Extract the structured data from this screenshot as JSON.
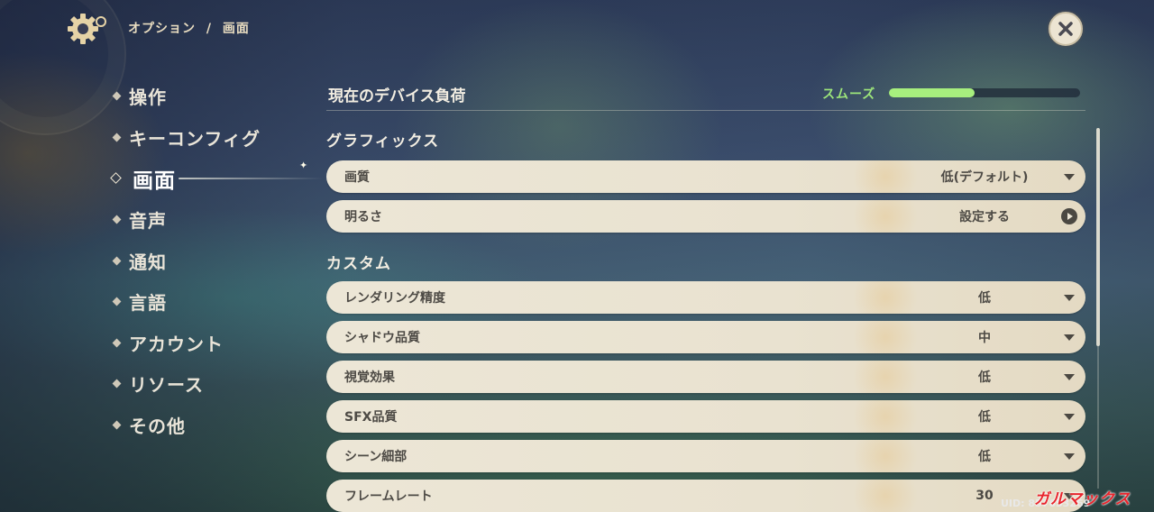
{
  "header": {
    "breadcrumb_root": "オプション",
    "breadcrumb_sep": "/",
    "breadcrumb_current": "画面"
  },
  "sidebar": {
    "items": [
      {
        "label": "操作"
      },
      {
        "label": "キーコンフィグ"
      },
      {
        "label": "画面",
        "active": true
      },
      {
        "label": "音声"
      },
      {
        "label": "通知"
      },
      {
        "label": "言語"
      },
      {
        "label": "アカウント"
      },
      {
        "label": "リソース"
      },
      {
        "label": "その他"
      }
    ]
  },
  "device_load": {
    "label": "現在のデバイス負荷",
    "status": "スムーズ",
    "level": 0.45,
    "color": "#a7ef7e"
  },
  "graphics": {
    "title": "グラフィックス",
    "rows": [
      {
        "label": "画質",
        "value": "低(デフォルト)",
        "control": "dropdown"
      },
      {
        "label": "明るさ",
        "value": "設定する",
        "control": "action"
      }
    ]
  },
  "custom": {
    "title": "カスタム",
    "rows": [
      {
        "label": "レンダリング精度",
        "value": "低",
        "control": "dropdown"
      },
      {
        "label": "シャドウ品質",
        "value": "中",
        "control": "dropdown"
      },
      {
        "label": "視覚効果",
        "value": "低",
        "control": "dropdown"
      },
      {
        "label": "SFX品質",
        "value": "低",
        "control": "dropdown"
      },
      {
        "label": "シーン細部",
        "value": "低",
        "control": "dropdown"
      },
      {
        "label": "フレームレート",
        "value": "30",
        "control": "dropdown"
      }
    ]
  },
  "footer": {
    "uid": "UID: 857653269",
    "watermark": "ガルマックス"
  }
}
